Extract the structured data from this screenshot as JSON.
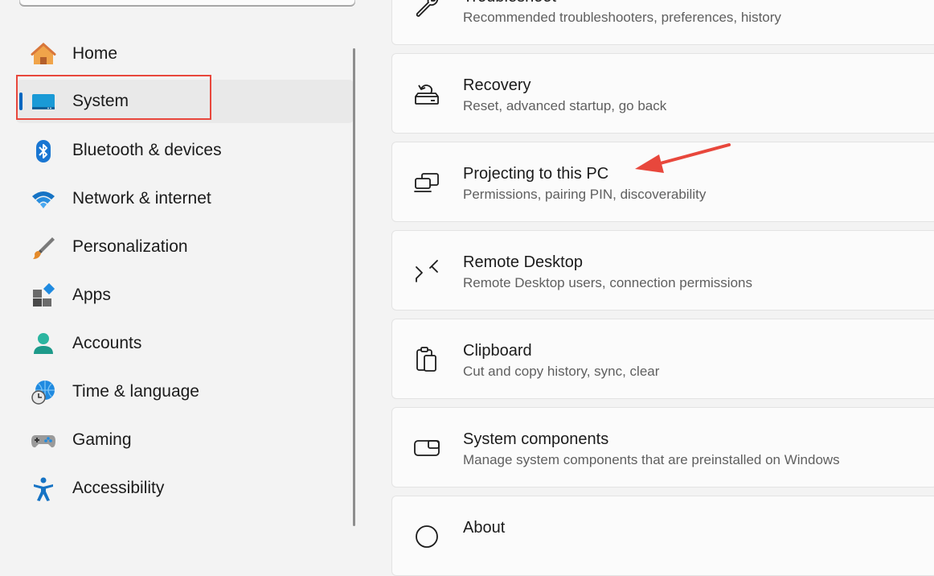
{
  "sidebar": {
    "items": [
      {
        "label": "Home",
        "icon": "home-icon"
      },
      {
        "label": "System",
        "icon": "system-monitor-icon",
        "selected": true
      },
      {
        "label": "Bluetooth & devices",
        "icon": "bluetooth-icon"
      },
      {
        "label": "Network & internet",
        "icon": "wifi-icon"
      },
      {
        "label": "Personalization",
        "icon": "paintbrush-icon"
      },
      {
        "label": "Apps",
        "icon": "apps-icon"
      },
      {
        "label": "Accounts",
        "icon": "person-icon"
      },
      {
        "label": "Time & language",
        "icon": "globe-clock-icon"
      },
      {
        "label": "Gaming",
        "icon": "gamepad-icon"
      },
      {
        "label": "Accessibility",
        "icon": "accessibility-icon"
      }
    ]
  },
  "main": {
    "cards": [
      {
        "title": "Troubleshoot",
        "subtitle": "Recommended troubleshooters, preferences, history",
        "icon": "wrench-icon"
      },
      {
        "title": "Recovery",
        "subtitle": "Reset, advanced startup, go back",
        "icon": "recovery-icon"
      },
      {
        "title": "Projecting to this PC",
        "subtitle": "Permissions, pairing PIN, discoverability",
        "icon": "projecting-icon"
      },
      {
        "title": "Remote Desktop",
        "subtitle": "Remote Desktop users, connection permissions",
        "icon": "remote-desktop-icon"
      },
      {
        "title": "Clipboard",
        "subtitle": "Cut and copy history, sync, clear",
        "icon": "clipboard-icon"
      },
      {
        "title": "System components",
        "subtitle": "Manage system components that are preinstalled on Windows",
        "icon": "system-components-icon"
      },
      {
        "title": "About",
        "subtitle": "",
        "icon": "info-icon"
      }
    ]
  },
  "colors": {
    "accent": "#0067c0",
    "annotation_red": "#e8473c"
  }
}
